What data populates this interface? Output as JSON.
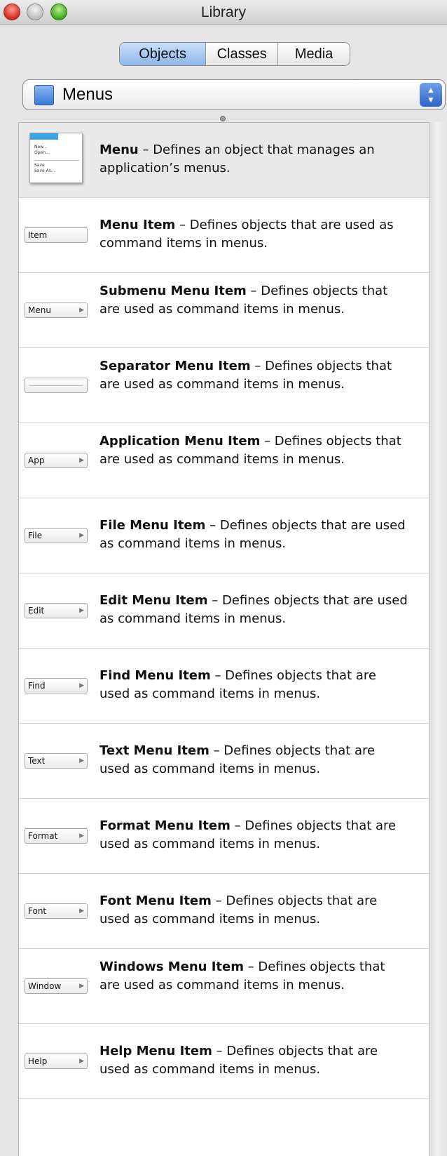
{
  "window": {
    "title": "Library"
  },
  "tabs": [
    {
      "label": "Objects",
      "selected": true
    },
    {
      "label": "Classes",
      "selected": false
    },
    {
      "label": "Media",
      "selected": false
    }
  ],
  "popup": {
    "label": "Menus",
    "icon": "folder-icon",
    "arrows": "▲▼"
  },
  "menu_preview": {
    "items": [
      "New...",
      "Open...",
      "Save",
      "Save As..."
    ]
  },
  "items": [
    {
      "title": "Menu",
      "desc": " – Defines an object that manages an application’s menus.",
      "icon": "menu",
      "btn": "",
      "selected": true
    },
    {
      "title": "Menu Item",
      "desc": " – Defines objects that are used as command items in menus.",
      "icon": "button",
      "btn": "Item",
      "arrow": false
    },
    {
      "title": "Submenu Menu Item",
      "desc": " – Defines objects that are used as command items in menus.",
      "icon": "button",
      "btn": "Menu",
      "arrow": true
    },
    {
      "title": "Separator Menu Item",
      "desc": " – Defines objects that are used as command items in menus.",
      "icon": "separator",
      "btn": ""
    },
    {
      "title": "Application Menu Item",
      "desc": " – Defines objects that are used as command items in menus.",
      "icon": "button",
      "btn": "App",
      "arrow": true
    },
    {
      "title": "File Menu Item",
      "desc": " – Defines objects that are used as command items in menus.",
      "icon": "button",
      "btn": "File",
      "arrow": true
    },
    {
      "title": "Edit Menu Item",
      "desc": " – Defines objects that are used as command items in menus.",
      "icon": "button",
      "btn": "Edit",
      "arrow": true
    },
    {
      "title": "Find Menu Item",
      "desc": " – Defines objects that are used as command items in menus.",
      "icon": "button",
      "btn": "Find",
      "arrow": true
    },
    {
      "title": "Text Menu Item",
      "desc": " – Defines objects that are used as command items in menus.",
      "icon": "button",
      "btn": "Text",
      "arrow": true
    },
    {
      "title": "Format Menu Item",
      "desc": " – Defines objects that are used as command items in menus.",
      "icon": "button",
      "btn": "Format",
      "arrow": true
    },
    {
      "title": "Font Menu Item",
      "desc": " – Defines objects that are used as command items in menus.",
      "icon": "button",
      "btn": "Font",
      "arrow": true
    },
    {
      "title": "Windows Menu Item",
      "desc": " – Defines objects that are used as command items in menus.",
      "icon": "button",
      "btn": "Window",
      "arrow": true
    },
    {
      "title": "Help Menu Item",
      "desc": " – Defines objects that are used as command items in menus.",
      "icon": "button",
      "btn": "Help",
      "arrow": true
    }
  ]
}
